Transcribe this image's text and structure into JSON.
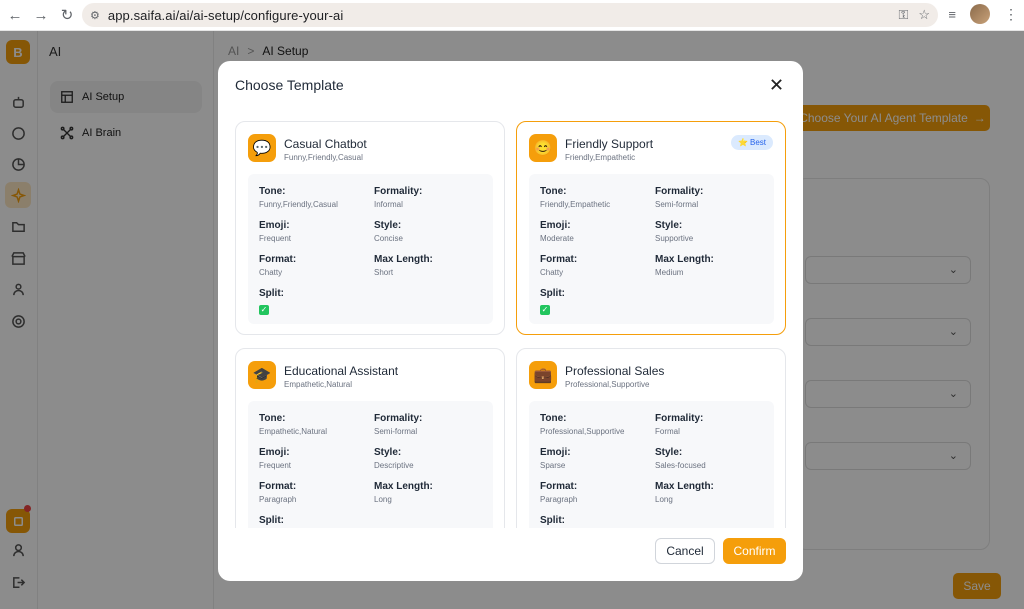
{
  "browser": {
    "url": "app.saifa.ai/ai/ai-setup/configure-your-ai"
  },
  "rail": {
    "logo": "B"
  },
  "sidebar": {
    "title": "AI",
    "items": [
      {
        "label": "AI Setup"
      },
      {
        "label": "AI Brain"
      }
    ]
  },
  "breadcrumb": {
    "root": "AI",
    "separator": ">",
    "current": "AI Setup"
  },
  "background": {
    "choose_template_button": "Choose Your AI Agent Template",
    "save_button": "Save"
  },
  "modal": {
    "title": "Choose Template",
    "cancel_label": "Cancel",
    "confirm_label": "Confirm",
    "attr_labels": {
      "tone": "Tone:",
      "formality": "Formality:",
      "emoji": "Emoji:",
      "style": "Style:",
      "format": "Format:",
      "max_length": "Max Length:",
      "split": "Split:"
    },
    "templates": [
      {
        "name": "Casual Chatbot",
        "tags": "Funny,Friendly,Casual",
        "icon": "💬",
        "tone": "Funny,Friendly,Casual",
        "formality": "Informal",
        "emoji": "Frequent",
        "style": "Concise",
        "format": "Chatty",
        "max_length": "Short",
        "split": "✓"
      },
      {
        "name": "Friendly Support",
        "tags": "Friendly,Empathetic",
        "icon": "😊",
        "badge": "Best",
        "badge_icon": "⭐",
        "tone": "Friendly,Empathetic",
        "formality": "Semi-formal",
        "emoji": "Moderate",
        "style": "Supportive",
        "format": "Chatty",
        "max_length": "Medium",
        "split": "✓"
      },
      {
        "name": "Educational Assistant",
        "tags": "Empathetic,Natural",
        "icon": "🎓",
        "tone": "Empathetic,Natural",
        "formality": "Semi-formal",
        "emoji": "Frequent",
        "style": "Descriptive",
        "format": "Paragraph",
        "max_length": "Long"
      },
      {
        "name": "Professional Sales",
        "tags": "Professional,Supportive",
        "icon": "💼",
        "tone": "Professional,Supportive",
        "formality": "Formal",
        "emoji": "Sparse",
        "style": "Sales-focused",
        "format": "Paragraph",
        "max_length": "Long"
      }
    ]
  },
  "colors": {
    "accent": "#f59e0b",
    "badge_bg": "#dbeafe",
    "badge_text": "#2563eb",
    "check": "#22c55e"
  }
}
